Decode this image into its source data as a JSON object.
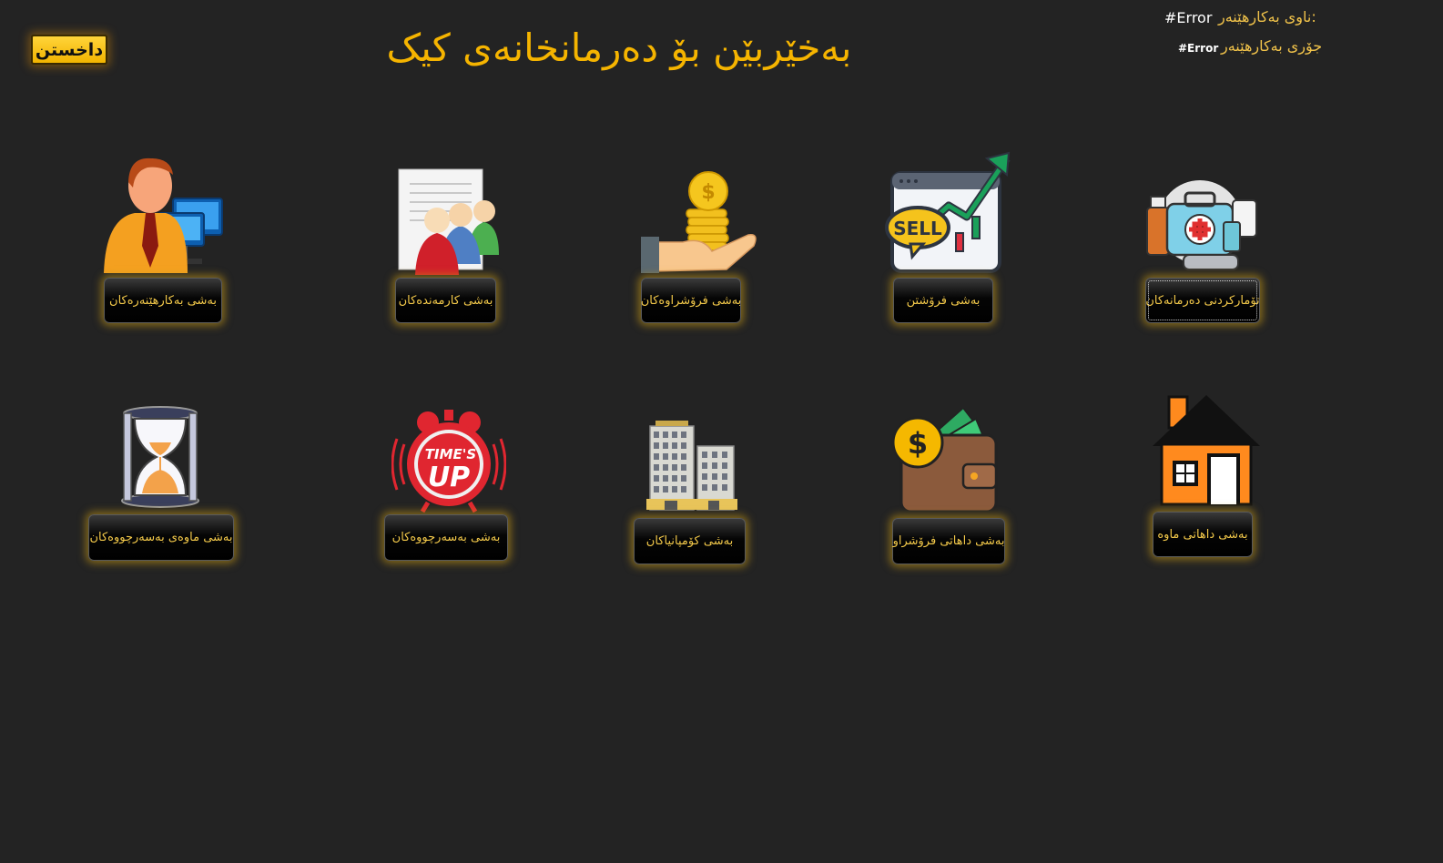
{
  "header": {
    "close_label": "داخستن",
    "title": "بەخێربێن بۆ دەرمانخانەی کیک",
    "user_name_label": "ناوی بەکارهێنەر:",
    "user_name_value": "#Error",
    "user_type_label": "جۆری بەکارهێنەر",
    "user_type_value": "#Error"
  },
  "row1": [
    {
      "icon": "user-computer-icon",
      "label": "بەشی بەکارهێنەرەکان"
    },
    {
      "icon": "employees-icon",
      "label": "بەشی کارمەندەکان"
    },
    {
      "icon": "coins-hand-icon",
      "label": "بەشی فرۆشراوەکان"
    },
    {
      "icon": "sell-chart-icon",
      "label": "بەشی فرۆشتن"
    },
    {
      "icon": "medicine-kit-icon",
      "label": "تۆمارکردنی دەرمانەکان"
    }
  ],
  "row2": [
    {
      "icon": "hourglass-icon",
      "label": "بەشی ماوەی بەسەرچووەکان"
    },
    {
      "icon": "alarm-clock-icon",
      "label": "بەشی بەسەرچووەکان"
    },
    {
      "icon": "buildings-icon",
      "label": "بەشی کۆمپانیاکان"
    },
    {
      "icon": "wallet-icon",
      "label": "بەشی داهاتی فرۆشراو"
    },
    {
      "icon": "house-icon",
      "label": "بەشی داهاتی ماوە"
    }
  ],
  "icon_text": {
    "sell": "SELL",
    "times": "TIME'S",
    "up": "UP",
    "dollar": "$"
  },
  "colors": {
    "background": "#232323",
    "accent": "#f5b400",
    "button_text": "#f3c94a"
  }
}
